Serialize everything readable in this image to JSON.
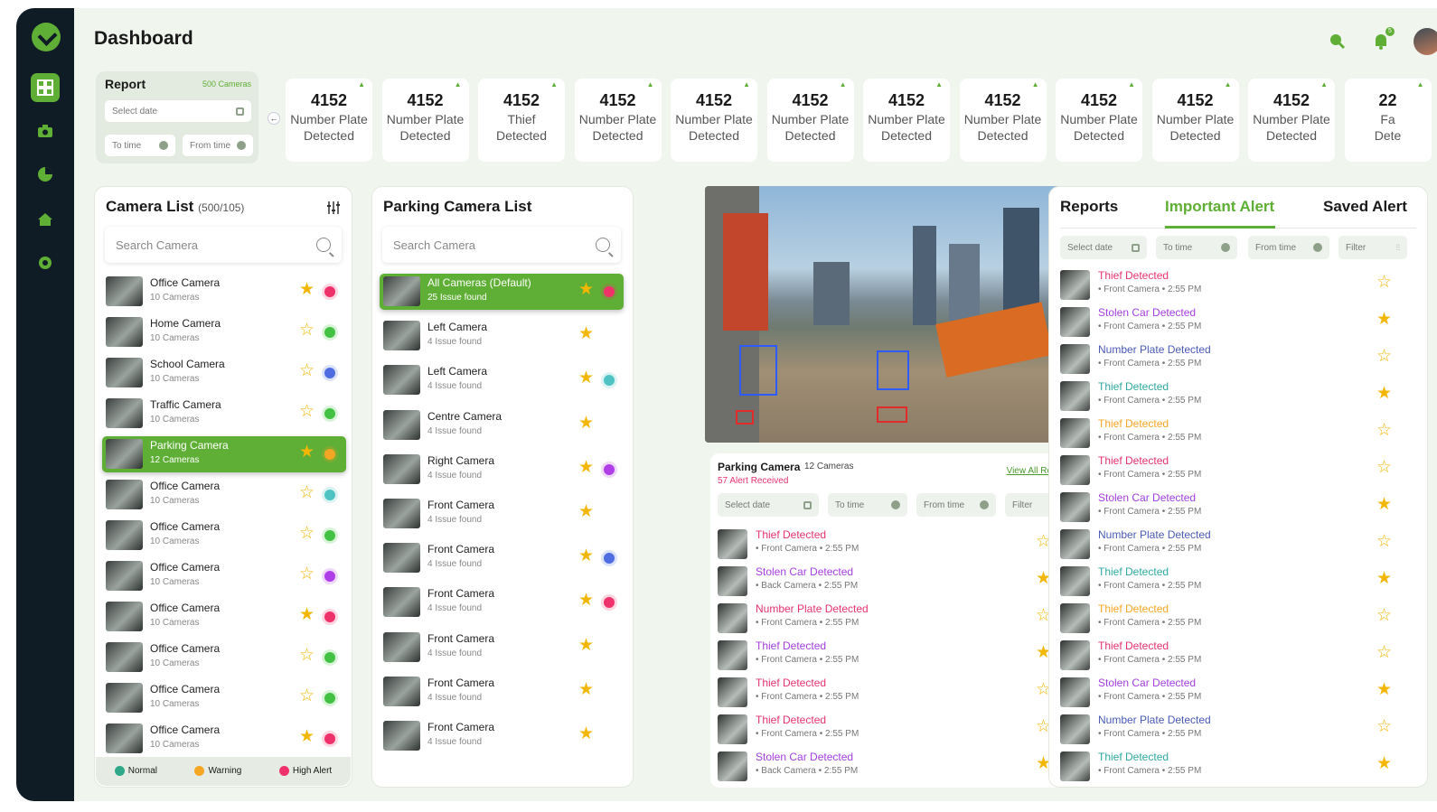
{
  "header": {
    "title": "Dashboard",
    "notif_count": "5"
  },
  "report": {
    "title": "Report",
    "count": "500 Cameras",
    "select_date": "Select date",
    "to_time": "To time",
    "from_time": "From time"
  },
  "stats": [
    {
      "num": "4152",
      "l1": "Number Plate",
      "l2": "Detected"
    },
    {
      "num": "4152",
      "l1": "Number Plate",
      "l2": "Detected"
    },
    {
      "num": "4152",
      "l1": "Thief",
      "l2": "Detected"
    },
    {
      "num": "4152",
      "l1": "Number Plate",
      "l2": "Detected"
    },
    {
      "num": "4152",
      "l1": "Number Plate",
      "l2": "Detected"
    },
    {
      "num": "4152",
      "l1": "Number Plate",
      "l2": "Detected"
    },
    {
      "num": "4152",
      "l1": "Number Plate",
      "l2": "Detected"
    },
    {
      "num": "4152",
      "l1": "Number Plate",
      "l2": "Detected"
    },
    {
      "num": "4152",
      "l1": "Number Plate",
      "l2": "Detected"
    },
    {
      "num": "4152",
      "l1": "Number Plate",
      "l2": "Detected"
    },
    {
      "num": "4152",
      "l1": "Number Plate",
      "l2": "Detected"
    },
    {
      "num": "22",
      "l1": "Fa",
      "l2": "Dete"
    }
  ],
  "camera_list": {
    "title": "Camera List",
    "count": "(500/105)",
    "search": "Search Camera",
    "items": [
      {
        "name": "Office Camera",
        "sub": "10 Cameras",
        "star": "filled",
        "dot": "#f0326a"
      },
      {
        "name": "Home Camera",
        "sub": "10 Cameras",
        "star": "empty",
        "dot": "#42c142"
      },
      {
        "name": "School Camera",
        "sub": "10 Cameras",
        "star": "empty",
        "dot": "#4f6de0"
      },
      {
        "name": "Traffic Camera",
        "sub": "10 Cameras",
        "star": "empty",
        "dot": "#42c142"
      },
      {
        "name": "Parking Camera",
        "sub": "12 Cameras",
        "star": "filled",
        "dot": "#f5a623",
        "selected": true
      },
      {
        "name": "Office Camera",
        "sub": "10 Cameras",
        "star": "empty",
        "dot": "#4fc3c3"
      },
      {
        "name": "Office Camera",
        "sub": "10 Cameras",
        "star": "empty",
        "dot": "#42c142"
      },
      {
        "name": "Office Camera",
        "sub": "10 Cameras",
        "star": "empty",
        "dot": "#b03ee8"
      },
      {
        "name": "Office Camera",
        "sub": "10 Cameras",
        "star": "filled",
        "dot": "#f0326a"
      },
      {
        "name": "Office Camera",
        "sub": "10 Cameras",
        "star": "empty",
        "dot": "#42c142"
      },
      {
        "name": "Office Camera",
        "sub": "10 Cameras",
        "star": "empty",
        "dot": "#42c142"
      },
      {
        "name": "Office Camera",
        "sub": "10 Cameras",
        "star": "filled",
        "dot": "#f0326a"
      }
    ],
    "legend": [
      {
        "label": "Normal",
        "color": "#2fa889"
      },
      {
        "label": "Warning",
        "color": "#f5a623"
      },
      {
        "label": "High Alert",
        "color": "#f0326a"
      }
    ]
  },
  "parking_list": {
    "title": "Parking Camera List",
    "search": "Search Camera",
    "items": [
      {
        "name": "All Cameras  (Default)",
        "sub": "25 Issue found",
        "star": "filled",
        "dot": "#f0326a",
        "selected": true
      },
      {
        "name": "Left Camera",
        "sub": "4 Issue found",
        "star": "filled",
        "dot": ""
      },
      {
        "name": "Left Camera",
        "sub": "4 Issue found",
        "star": "filled",
        "dot": "#4fc3c3"
      },
      {
        "name": "Centre Camera",
        "sub": "4 Issue found",
        "star": "filled",
        "dot": ""
      },
      {
        "name": "Right Camera",
        "sub": "4 Issue found",
        "star": "filled",
        "dot": "#b03ee8"
      },
      {
        "name": "Front Camera",
        "sub": "4 Issue found",
        "star": "filled",
        "dot": ""
      },
      {
        "name": "Front Camera",
        "sub": "4 Issue found",
        "star": "filled",
        "dot": "#4f6de0"
      },
      {
        "name": "Front Camera",
        "sub": "4 Issue found",
        "star": "filled",
        "dot": "#f0326a"
      },
      {
        "name": "Front Camera",
        "sub": "4 Issue found",
        "star": "filled",
        "dot": ""
      },
      {
        "name": "Front Camera",
        "sub": "4 Issue found",
        "star": "filled",
        "dot": ""
      },
      {
        "name": "Front Camera",
        "sub": "4 Issue found",
        "star": "filled",
        "dot": ""
      }
    ]
  },
  "feed": {
    "title": "Parking Camera",
    "cams": "12 Cameras",
    "alerts": "57 Alert Received",
    "view_all": "View All Report →",
    "select_date": "Select date",
    "to_time": "To time",
    "from_time": "From time",
    "filter": "Filter",
    "items": [
      {
        "title": "Thief Detected",
        "color": "#e5336d",
        "cam": "Front Camera",
        "time": "2:55 PM",
        "star": "empty"
      },
      {
        "title": "Stolen Car Detected",
        "color": "#a43ee0",
        "cam": "Back Camera",
        "time": "2:55 PM",
        "star": "filled"
      },
      {
        "title": "Number Plate Detected",
        "color": "#e5336d",
        "cam": "Front Camera",
        "time": "2:55 PM",
        "star": "empty"
      },
      {
        "title": "Thief Detected",
        "color": "#a43ee0",
        "cam": "Front Camera",
        "time": "2:55 PM",
        "star": "filled"
      },
      {
        "title": "Thief Detected",
        "color": "#e5336d",
        "cam": "Front Camera",
        "time": "2:55 PM",
        "star": "empty"
      },
      {
        "title": "Thief Detected",
        "color": "#e5336d",
        "cam": "Front Camera",
        "time": "2:55 PM",
        "star": "empty"
      },
      {
        "title": "Stolen Car Detected",
        "color": "#a43ee0",
        "cam": "Back Camera",
        "time": "2:55 PM",
        "star": "filled"
      }
    ]
  },
  "reports": {
    "tabs": [
      "Reports",
      "Important Alert",
      "Saved Alert"
    ],
    "select_date": "Select date",
    "to_time": "To time",
    "from_time": "From time",
    "filter": "Filter",
    "items": [
      {
        "title": "Thief Detected",
        "color": "#e5336d",
        "cam": "Front Camera",
        "time": "2:55 PM",
        "star": "empty"
      },
      {
        "title": "Stolen Car Detected",
        "color": "#a43ee0",
        "cam": "Front Camera",
        "time": "2:55 PM",
        "star": "filled"
      },
      {
        "title": "Number Plate Detected",
        "color": "#4a5bb5",
        "cam": "Front Camera",
        "time": "2:55 PM",
        "star": "empty"
      },
      {
        "title": "Thief Detected",
        "color": "#2fa8a0",
        "cam": "Front Camera",
        "time": "2:55 PM",
        "star": "filled"
      },
      {
        "title": "Thief Detected",
        "color": "#f5a623",
        "cam": "Front Camera",
        "time": "2:55 PM",
        "star": "empty"
      },
      {
        "title": "Thief Detected",
        "color": "#e5336d",
        "cam": "Front Camera",
        "time": "2:55 PM",
        "star": "empty"
      },
      {
        "title": "Stolen Car Detected",
        "color": "#a43ee0",
        "cam": "Front Camera",
        "time": "2:55 PM",
        "star": "filled"
      },
      {
        "title": "Number Plate Detected",
        "color": "#4a5bb5",
        "cam": "Front Camera",
        "time": "2:55 PM",
        "star": "empty"
      },
      {
        "title": "Thief Detected",
        "color": "#2fa8a0",
        "cam": "Front Camera",
        "time": "2:55 PM",
        "star": "filled"
      },
      {
        "title": "Thief Detected",
        "color": "#f5a623",
        "cam": "Front Camera",
        "time": "2:55 PM",
        "star": "empty"
      },
      {
        "title": "Thief Detected",
        "color": "#e5336d",
        "cam": "Front Camera",
        "time": "2:55 PM",
        "star": "empty"
      },
      {
        "title": "Stolen Car Detected",
        "color": "#a43ee0",
        "cam": "Front Camera",
        "time": "2:55 PM",
        "star": "filled"
      },
      {
        "title": "Number Plate Detected",
        "color": "#4a5bb5",
        "cam": "Front Camera",
        "time": "2:55 PM",
        "star": "empty"
      },
      {
        "title": "Thief Detected",
        "color": "#2fa8a0",
        "cam": "Front Camera",
        "time": "2:55 PM",
        "star": "filled"
      }
    ]
  }
}
